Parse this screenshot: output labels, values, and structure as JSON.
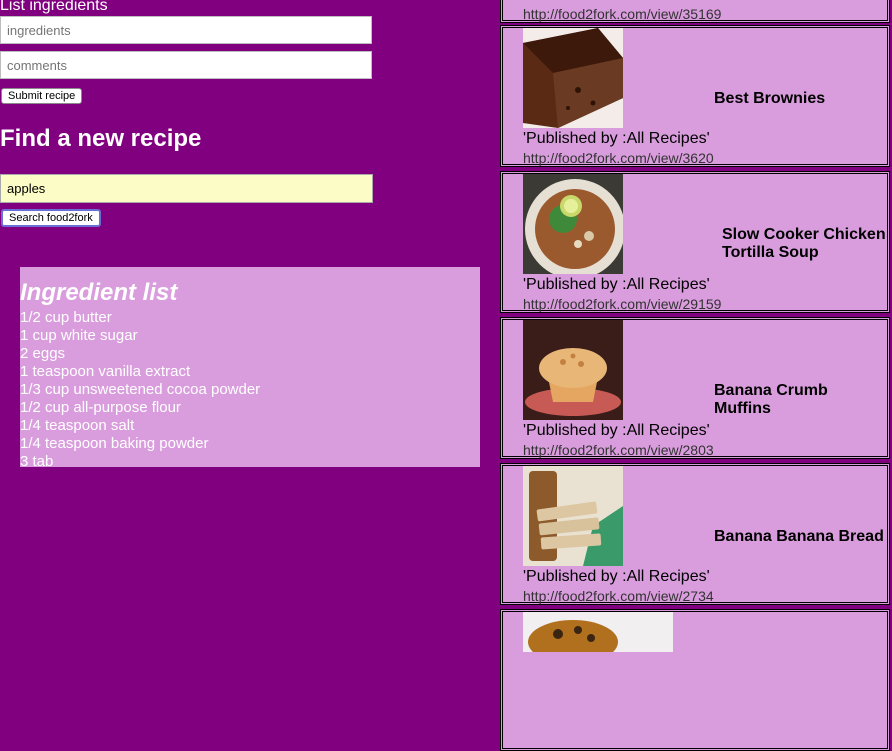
{
  "form": {
    "list_title": "List ingredients",
    "ingredients_placeholder": "ingredients",
    "comments_placeholder": "comments",
    "submit_label": "Submit recipe"
  },
  "search": {
    "title": "Find a new recipe",
    "value": "apples",
    "button_label": "Search food2fork"
  },
  "ingredient_list": {
    "heading": "Ingredient list",
    "items": [
      "1/2 cup butter",
      "1 cup white sugar",
      "2 eggs",
      "1 teaspoon vanilla extract",
      "1/3 cup unsweetened cocoa powder",
      "1/2 cup all-purpose flour",
      "1/4 teaspoon salt",
      "1/4 teaspoon baking powder",
      "3 tab"
    ]
  },
  "recipes": [
    {
      "title": "",
      "publisher": "",
      "url": "http://food2fork.com/view/35169"
    },
    {
      "title": "Best Brownies",
      "publisher": "'Published by :All Recipes'",
      "url": "http://food2fork.com/view/3620",
      "image": "brownie"
    },
    {
      "title": "Slow Cooker Chicken Tortilla Soup",
      "publisher": "'Published by :All Recipes'",
      "url": "http://food2fork.com/view/29159",
      "image": "soup"
    },
    {
      "title": "Banana Crumb Muffins",
      "publisher": "'Published by :All Recipes'",
      "url": "http://food2fork.com/view/2803",
      "image": "muffin"
    },
    {
      "title": "Banana Banana Bread",
      "publisher": "'Published by :All Recipes'",
      "url": "http://food2fork.com/view/2734",
      "image": "bread"
    },
    {
      "title": "",
      "publisher": "",
      "url": "",
      "image": "cake"
    }
  ],
  "colors": {
    "background": "#800080",
    "panel": "#d99ddd",
    "search_field": "#fbfcc6"
  }
}
